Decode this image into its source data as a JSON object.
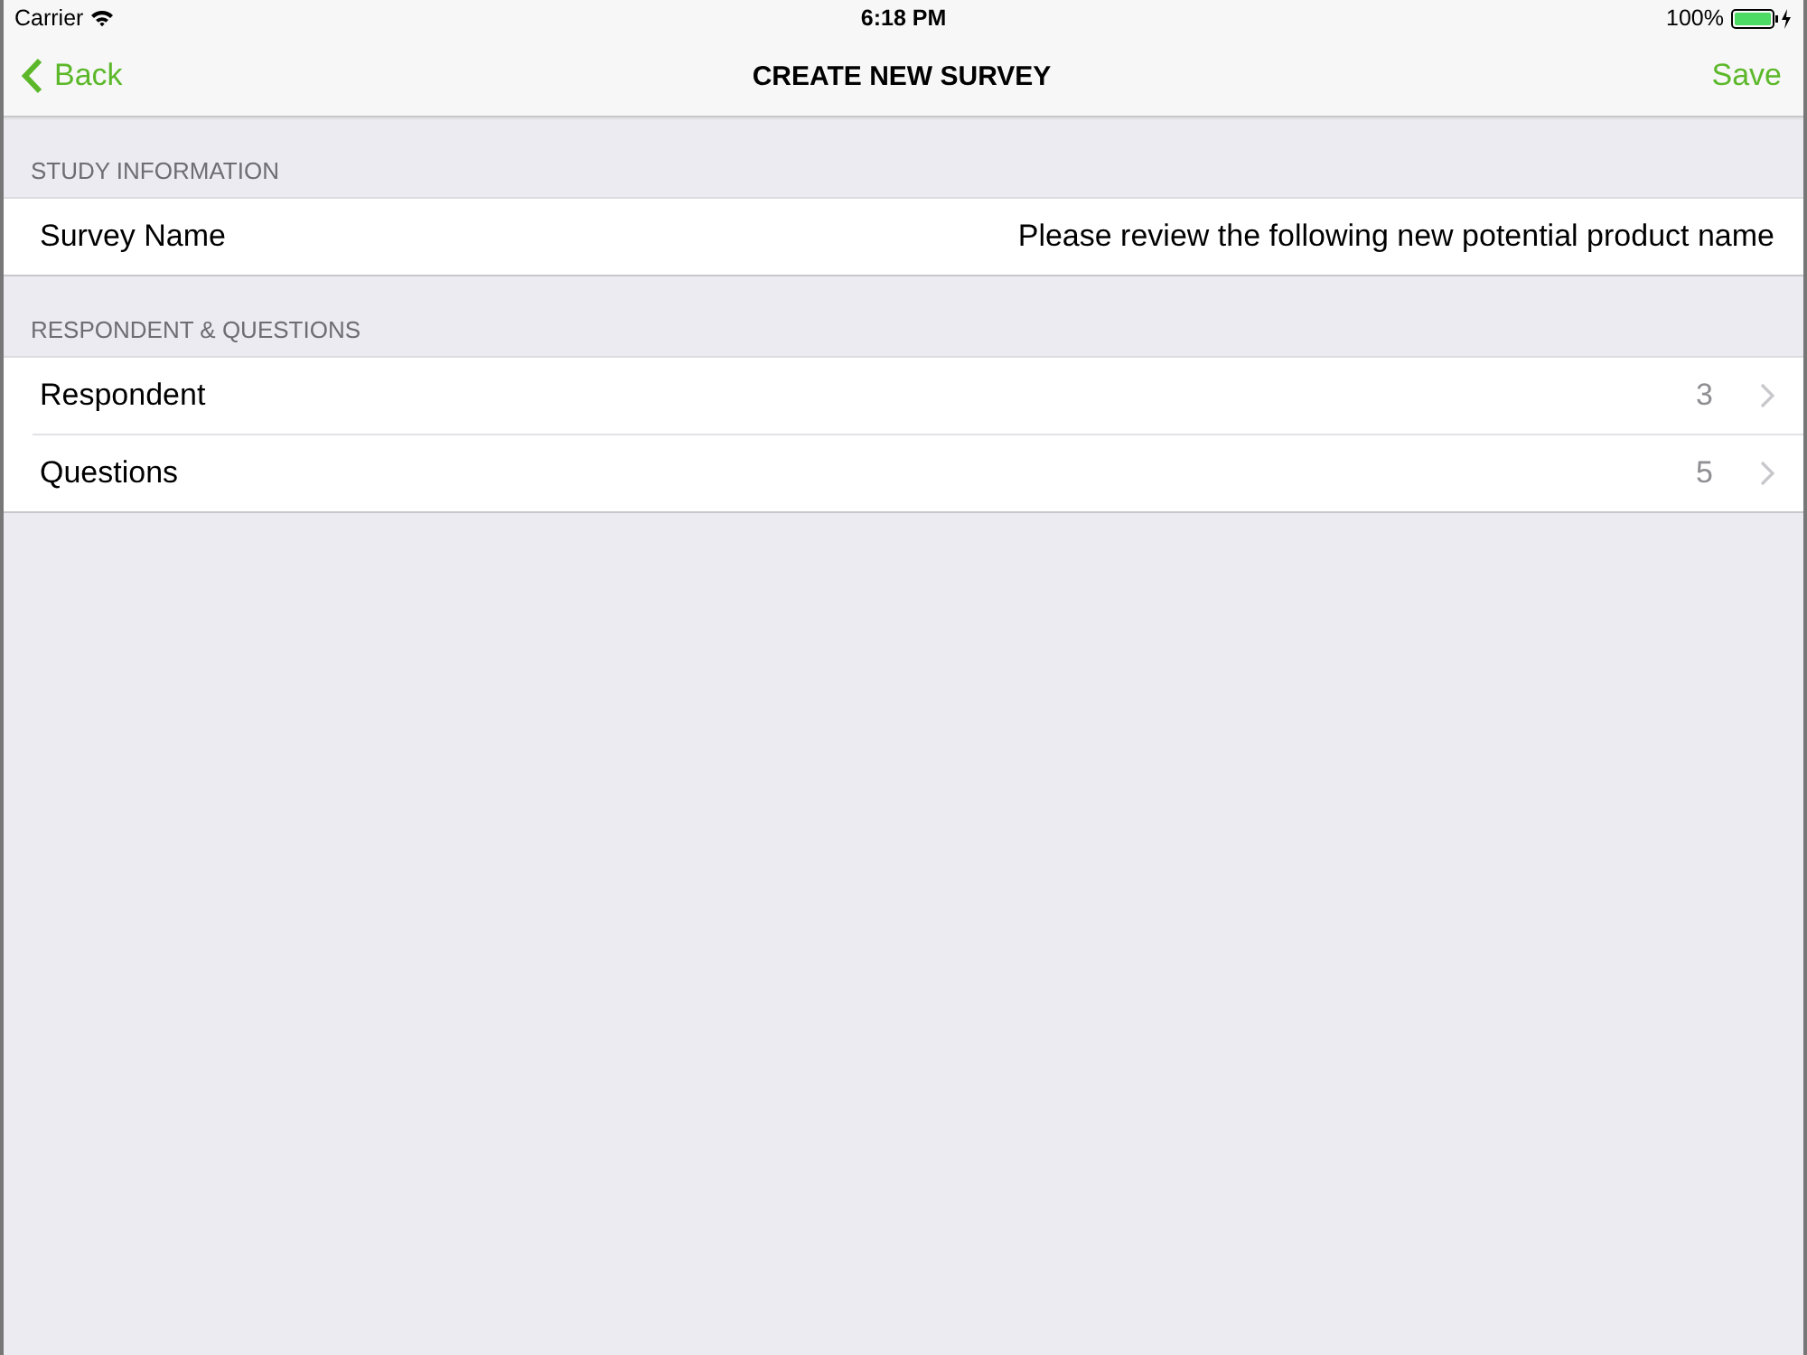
{
  "status_bar": {
    "carrier": "Carrier",
    "time": "6:18 PM",
    "battery": "100%"
  },
  "nav_bar": {
    "back": "Back",
    "title": "CREATE NEW SURVEY",
    "action": "Save"
  },
  "sections": [
    {
      "header": "STUDY INFORMATION",
      "rows": [
        {
          "kind": "value",
          "label": "Survey Name",
          "value": "Please review the following new potential product name"
        }
      ]
    },
    {
      "header": "RESPONDENT & QUESTIONS",
      "rows": [
        {
          "kind": "disclosure",
          "label": "Respondent",
          "value": "3"
        },
        {
          "kind": "disclosure",
          "label": "Questions",
          "value": "5"
        }
      ]
    }
  ]
}
